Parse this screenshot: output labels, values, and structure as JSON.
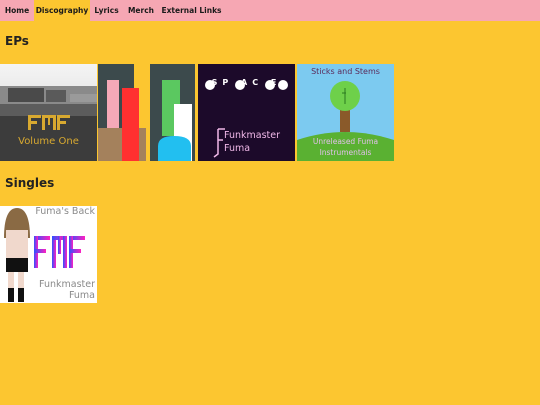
{
  "nav": {
    "items": [
      {
        "label": "Home"
      },
      {
        "label": "Discography"
      },
      {
        "label": "Lyrics"
      },
      {
        "label": "Merch"
      },
      {
        "label": "External Links"
      }
    ],
    "active": "Discography"
  },
  "sections": {
    "eps": {
      "title": "EPs",
      "albums": [
        {
          "logo": "FMF",
          "caption": "Volume One"
        },
        {},
        {},
        {
          "title": "SP AC E",
          "artist_line1": "Funkmaster",
          "artist_line2": "Fuma"
        },
        {
          "title": "Sticks and Stems",
          "subtitle_line1": "Unreleased Fuma",
          "subtitle_line2": "Instrumentals"
        }
      ]
    },
    "singles": {
      "title": "Singles",
      "albums": [
        {
          "title": "Fuma's Back",
          "logo": "FMF",
          "artist_line1": "Funkmaster",
          "artist_line2": "Fuma"
        }
      ]
    }
  },
  "colors": {
    "page_bg": "#fcc630",
    "nav_bg": "#f6a7b3",
    "fmf_gold": "#d8a930",
    "space_bg": "#1c0a2a",
    "space_text": "#f0b8e8"
  }
}
